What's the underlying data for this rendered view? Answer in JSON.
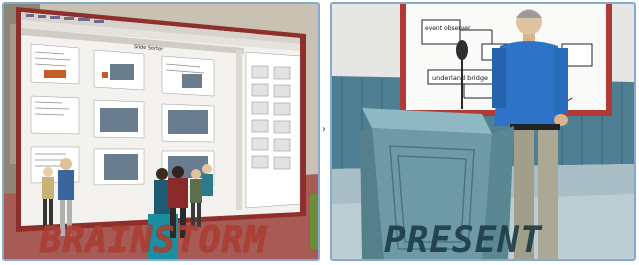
{
  "panels": [
    {
      "name": "brainstorm",
      "caption": "BRAINSTORM"
    },
    {
      "name": "present",
      "caption": "PRESENT"
    }
  ],
  "screen_tab": "Slide Sorter",
  "whiteboard": {
    "box_top": "event observer",
    "box_bottom": "underland bridge"
  },
  "colors": {
    "brainstorm_caption": "#ae3e32",
    "present_caption": "#1d3c46",
    "panel_border": "#86a9cf",
    "floor_brainstorm": "#a85a55",
    "wall_present": "#4f7f92",
    "podium": "#6d9aa6"
  }
}
